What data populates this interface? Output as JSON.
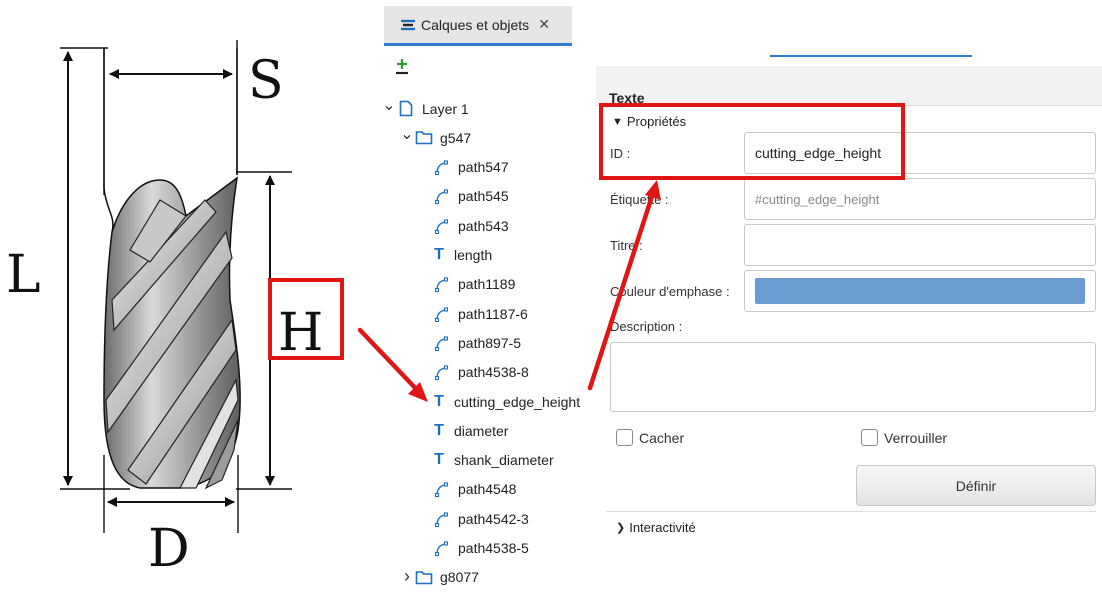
{
  "drawing": {
    "labels": {
      "S": "S",
      "L": "L",
      "H": "H",
      "D": "D"
    }
  },
  "layers_panel": {
    "tab": {
      "label": "Calques et objets",
      "close": "✕"
    },
    "add_icon": "add-layer-icon",
    "tree": [
      {
        "label": "Layer 1",
        "icon": "page-icon",
        "expanded": true
      },
      {
        "label": "g547",
        "icon": "folder-icon",
        "expanded": true
      },
      {
        "label": "path547",
        "icon": "path-icon"
      },
      {
        "label": "path545",
        "icon": "path-icon"
      },
      {
        "label": "path543",
        "icon": "path-icon"
      },
      {
        "label": "length",
        "icon": "text-icon"
      },
      {
        "label": "path1189",
        "icon": "path-icon"
      },
      {
        "label": "path1187-6",
        "icon": "path-icon"
      },
      {
        "label": "path897-5",
        "icon": "path-icon"
      },
      {
        "label": "path4538-8",
        "icon": "path-icon"
      },
      {
        "label": "cutting_edge_height",
        "icon": "text-icon"
      },
      {
        "label": "diameter",
        "icon": "text-icon"
      },
      {
        "label": "shank_diameter",
        "icon": "text-icon"
      },
      {
        "label": "path4548",
        "icon": "path-icon"
      },
      {
        "label": "path4542-3",
        "icon": "path-icon"
      },
      {
        "label": "path4538-5",
        "icon": "path-icon"
      },
      {
        "label": "g8077",
        "icon": "folder-icon",
        "expanded": false
      }
    ]
  },
  "props_panel": {
    "title": "Texte",
    "properties_section": "Propriétés",
    "id_label": "ID :",
    "id_value": "cutting_edge_height",
    "label_label": "Étiquette :",
    "label_placeholder": "#cutting_edge_height",
    "title_label": "Titre :",
    "title_value": "",
    "highlight_label": "Couleur d'emphase :",
    "highlight_color": "#6a9bd1",
    "description_label": "Description :",
    "description_value": "",
    "hide_label": "Cacher",
    "lock_label": "Verrouiller",
    "define_button": "Définir",
    "interactivity_section": "Interactivité"
  },
  "colors": {
    "accent": "#2f7fd0",
    "annotation_red": "#e01515",
    "text_icon": "#1d6fc1"
  }
}
